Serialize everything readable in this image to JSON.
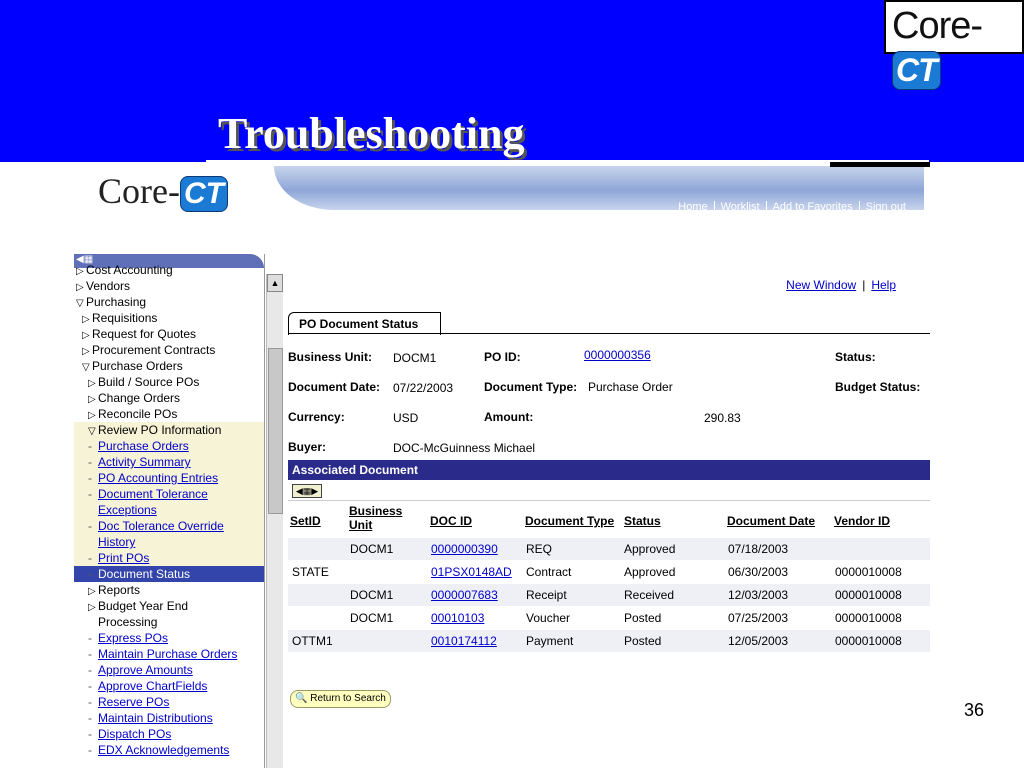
{
  "slide": {
    "title": "Troubleshooting",
    "page_number": "36",
    "logo": {
      "core": "Core-",
      "ct": "CT"
    }
  },
  "app": {
    "logo": {
      "core": "Core-",
      "ct": "CT"
    },
    "header_links": [
      "Home",
      "Worklist",
      "Add to Favorites",
      "Sign out"
    ],
    "menu": [
      {
        "label": "Cost Accounting",
        "type": "folder",
        "indent": 1
      },
      {
        "label": "Vendors",
        "type": "folder",
        "indent": 1
      },
      {
        "label": "Purchasing",
        "type": "open",
        "indent": 1
      },
      {
        "label": "Requisitions",
        "type": "folder",
        "indent": 2
      },
      {
        "label": "Request for Quotes",
        "type": "folder",
        "indent": 2
      },
      {
        "label": "Procurement Contracts",
        "type": "folder",
        "indent": 2
      },
      {
        "label": "Purchase Orders",
        "type": "open",
        "indent": 2
      },
      {
        "label": "Build / Source POs",
        "type": "folder",
        "indent": 3
      },
      {
        "label": "Change Orders",
        "type": "folder",
        "indent": 3
      },
      {
        "label": "Reconcile POs",
        "type": "folder",
        "indent": 3
      },
      {
        "label": "Review PO Information",
        "type": "open",
        "indent": 3,
        "hl": true
      },
      {
        "label": "Purchase Orders",
        "type": "link",
        "indent": 3,
        "hl": true
      },
      {
        "label": "Activity Summary",
        "type": "link",
        "indent": 3,
        "hl": true
      },
      {
        "label": "PO Accounting Entries",
        "type": "link",
        "indent": 3,
        "hl": true
      },
      {
        "label": "Document Tolerance",
        "type": "link",
        "indent": 3,
        "hl": true
      },
      {
        "label": "Exceptions",
        "type": "link-cont",
        "indent": 3,
        "hl": true
      },
      {
        "label": "Doc Tolerance Override",
        "type": "link",
        "indent": 3,
        "hl": true
      },
      {
        "label": "History",
        "type": "link-cont",
        "indent": 3,
        "hl": true
      },
      {
        "label": "Print POs",
        "type": "link",
        "indent": 3,
        "hl": true
      },
      {
        "label": "Document Status",
        "type": "selected",
        "indent": 3
      },
      {
        "label": "Reports",
        "type": "folder",
        "indent": 3
      },
      {
        "label": "Budget Year End",
        "type": "folder",
        "indent": 3
      },
      {
        "label": "Processing",
        "type": "text-cont",
        "indent": 3
      },
      {
        "label": "Express POs",
        "type": "link",
        "indent": 3
      },
      {
        "label": "Maintain Purchase Orders",
        "type": "link",
        "indent": 3
      },
      {
        "label": "Approve Amounts",
        "type": "link",
        "indent": 3
      },
      {
        "label": "Approve ChartFields",
        "type": "link",
        "indent": 3
      },
      {
        "label": "Reserve POs",
        "type": "link",
        "indent": 3
      },
      {
        "label": "Maintain Distributions",
        "type": "link",
        "indent": 3
      },
      {
        "label": "Dispatch POs",
        "type": "link",
        "indent": 3
      },
      {
        "label": "EDX Acknowledgements",
        "type": "link",
        "indent": 3
      }
    ],
    "top_links": {
      "new_window": "New Window",
      "help": "Help"
    },
    "tab": "PO Document Status",
    "fields": {
      "business_unit_label": "Business Unit:",
      "business_unit": "DOCM1",
      "po_id_label": "PO ID:",
      "po_id": "0000000356",
      "status_label": "Status:",
      "document_date_label": "Document Date:",
      "document_date": "07/22/2003",
      "document_type_label": "Document Type:",
      "document_type": "Purchase Order",
      "budget_status_label": "Budget Status:",
      "currency_label": "Currency:",
      "currency": "USD",
      "amount_label": "Amount:",
      "amount": "290.83",
      "buyer_label": "Buyer:",
      "buyer": "DOC-McGuinness Michael"
    },
    "assoc": {
      "title": "Associated Document",
      "nav_icon": "◀▦▶",
      "columns": [
        "SetID",
        "Business Unit",
        "DOC ID",
        "Document Type",
        "Status",
        "Document Date",
        "Vendor ID"
      ],
      "rows": [
        {
          "setid": "",
          "bu": "DOCM1",
          "docid": "0000000390",
          "type": "REQ",
          "status": "Approved",
          "date": "07/18/2003",
          "vendor": ""
        },
        {
          "setid": "STATE",
          "bu": "",
          "docid": "01PSX0148AD",
          "type": "Contract",
          "status": "Approved",
          "date": "06/30/2003",
          "vendor": "0000010008"
        },
        {
          "setid": "",
          "bu": "DOCM1",
          "docid": "0000007683",
          "type": "Receipt",
          "status": "Received",
          "date": "12/03/2003",
          "vendor": "0000010008"
        },
        {
          "setid": "",
          "bu": "DOCM1",
          "docid": "00010103",
          "type": "Voucher",
          "status": "Posted",
          "date": "07/25/2003",
          "vendor": "0000010008"
        },
        {
          "setid": "OTTM1",
          "bu": "",
          "docid": "0010174112",
          "type": "Payment",
          "status": "Posted",
          "date": "12/05/2003",
          "vendor": "0000010008"
        }
      ]
    },
    "return_button": "Return to Search"
  }
}
